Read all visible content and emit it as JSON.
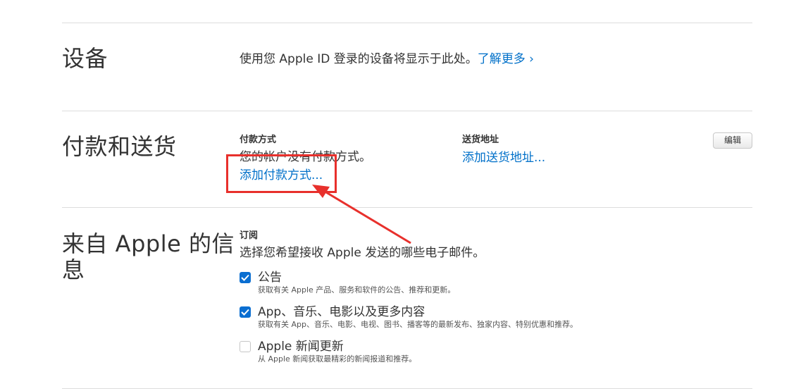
{
  "devices": {
    "title": "设备",
    "text": "使用您 Apple ID 登录的设备将显示于此处。",
    "link": "了解更多 ›"
  },
  "payment": {
    "title": "付款和送货",
    "method_label": "付款方式",
    "method_text": "您的帐户没有付款方式。",
    "add_method_link": "添加付款方式...",
    "shipping_label": "送货地址",
    "add_shipping_link": "添加送货地址...",
    "edit_button": "编辑"
  },
  "from_apple": {
    "title_line1": "来自 Apple 的信",
    "title_line2": "息",
    "subscription_label": "订阅",
    "subscription_text": "选择您希望接收 Apple 发送的哪些电子邮件。",
    "options": [
      {
        "title": "公告",
        "desc": "获取有关 Apple 产品、服务和软件的公告、推荐和更新。",
        "checked": true
      },
      {
        "title": "App、音乐、电影以及更多内容",
        "desc": "获取有关 App、音乐、电影、电视、图书、播客等的最新发布、独家内容、特别优惠和推荐。",
        "checked": true
      },
      {
        "title": "Apple 新闻更新",
        "desc": "从 Apple 新闻获取最精彩的新闻报道和推荐。",
        "checked": false
      }
    ]
  },
  "colors": {
    "link": "#0070c9",
    "checkbox_checked": "#0a6ed1",
    "annotation_red": "#e8302c"
  }
}
